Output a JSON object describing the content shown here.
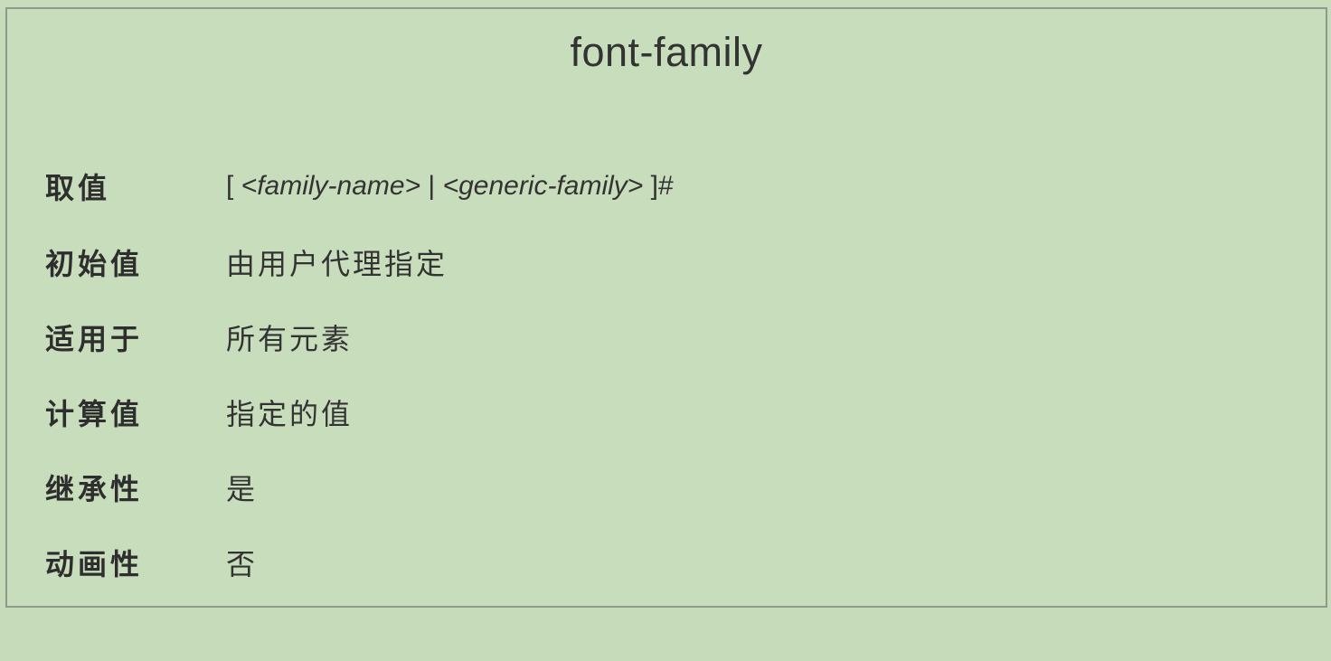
{
  "table": {
    "title": "font-family",
    "rows": [
      {
        "label": "取值",
        "value_parts": [
          "[ ",
          "<family-name>",
          " | ",
          "<generic-family>",
          " ]#"
        ]
      },
      {
        "label": "初始值",
        "value": "由用户代理指定"
      },
      {
        "label": "适用于",
        "value": "所有元素"
      },
      {
        "label": "计算值",
        "value": "指定的值"
      },
      {
        "label": "继承性",
        "value": "是"
      },
      {
        "label": "动画性",
        "value": "否"
      }
    ]
  },
  "colors": {
    "background": "#c5dbb9",
    "border": "#8f9a8a",
    "text": "#333333"
  }
}
